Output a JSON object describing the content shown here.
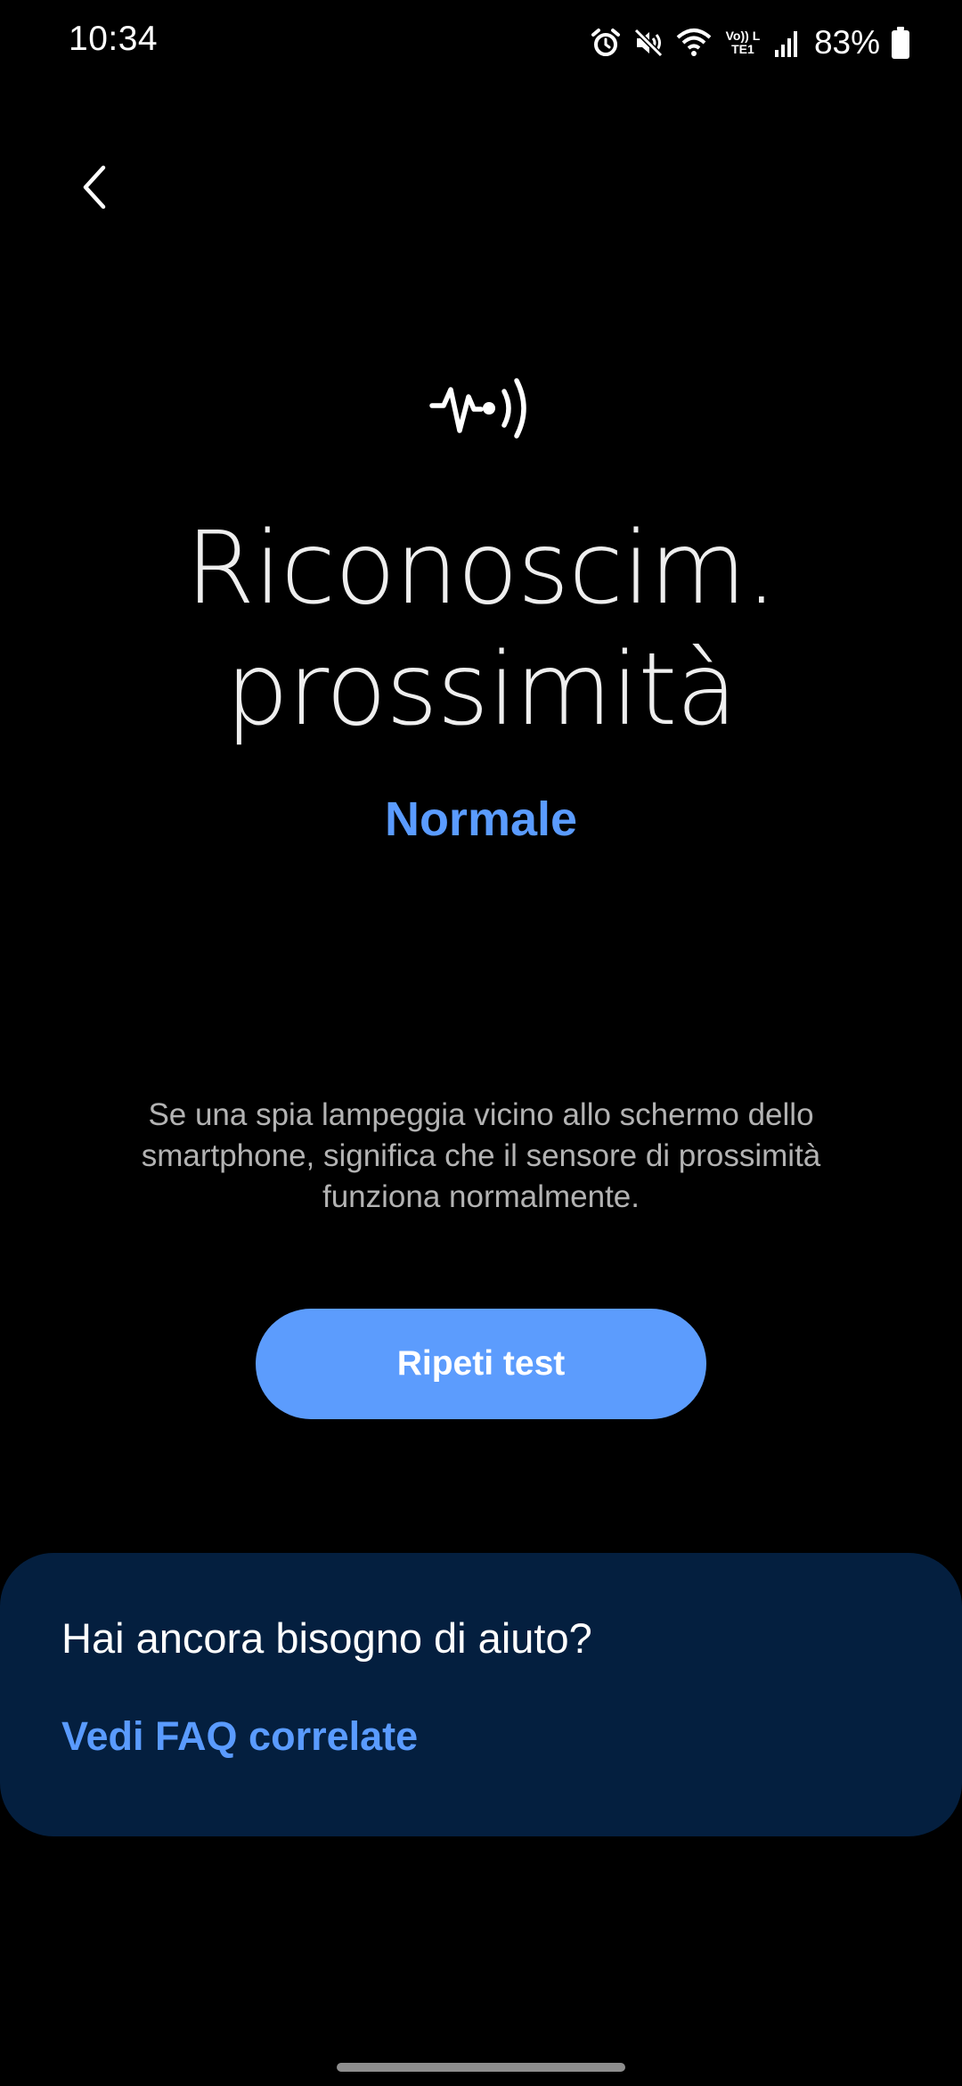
{
  "status_bar": {
    "time": "10:34",
    "battery_percent": "83%",
    "network_label": "Vo)) LTE1",
    "icons": [
      "alarm-icon",
      "mute-icon",
      "wifi-icon",
      "volte-icon",
      "signal-icon",
      "battery-icon"
    ]
  },
  "navigation": {
    "back_icon": "chevron-left-icon"
  },
  "test": {
    "icon": "proximity-sensor-icon",
    "title_line1": "Riconoscim.",
    "title_line2": "prossimità",
    "result": "Normale",
    "description": "Se una spia lampeggia vicino allo schermo dello smartphone, significa che il sensore di prossimità funziona normalmente.",
    "retry_label": "Ripeti test"
  },
  "help": {
    "title": "Hai ancora bisogno di aiuto?",
    "faq_label": "Vedi FAQ correlate"
  },
  "colors": {
    "background": "#000000",
    "accent": "#5a9bff",
    "button": "#5c9cfd",
    "card": "#041f3f",
    "description_text": "#b3b3b3"
  }
}
